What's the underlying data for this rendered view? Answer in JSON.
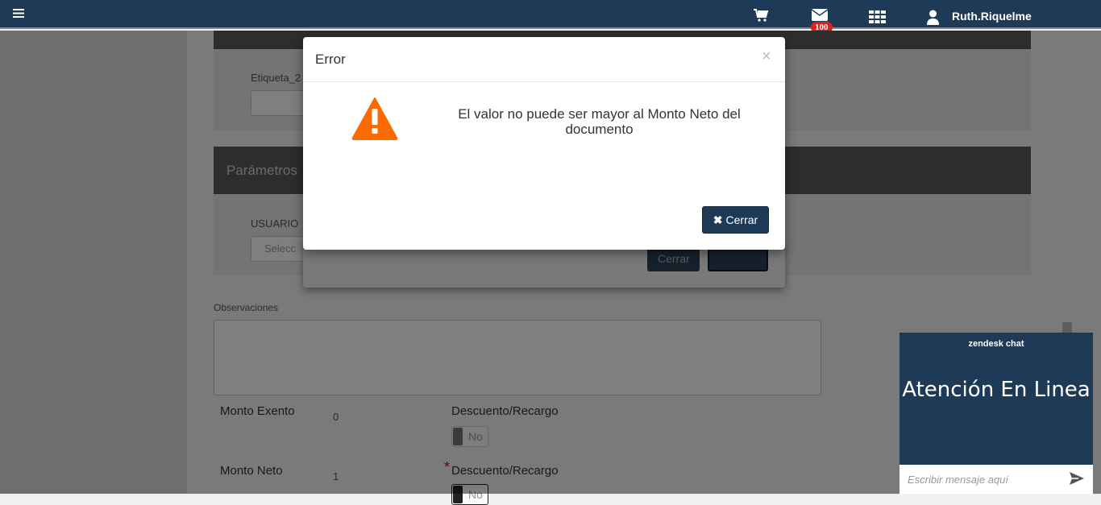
{
  "navbar": {
    "menu_icon": "hamburger-icon",
    "cart_icon": "cart-icon",
    "mail_icon": "envelope-icon",
    "mail_badge": "100",
    "apps_icon": "grid-icon",
    "user_icon": "user-icon",
    "username": "Ruth.Riquelme"
  },
  "background": {
    "field_label_1": "Etiqueta_2",
    "panel_title": "Parámetros",
    "usuario_label": "USUARIO",
    "usuario_placeholder": "Selecc",
    "under_cerrar": "Cerrar",
    "observaciones_label": "Observaciones",
    "monto_exento_label": "Monto Exento",
    "monto_exento_value": "0",
    "monto_neto_label": "Monto Neto",
    "monto_neto_value": "1",
    "descuento_label_1": "Descuento/Recargo",
    "descuento_label_2": "Descuento/Recargo",
    "required_mark": "*",
    "toggle_1": "No",
    "toggle_2": "No"
  },
  "modal": {
    "title": "Error",
    "close_symbol": "×",
    "icon": "warning-icon",
    "message": "El valor no puede ser mayor al Monto Neto del documento",
    "button_icon": "✖",
    "button_label": "Cerrar"
  },
  "chat": {
    "brand": "zendesk chat",
    "title": "Atención En Linea",
    "placeholder": "Escribir mensaje aquí",
    "send_icon": "send-icon"
  },
  "colors": {
    "navbar": "#1f3a56",
    "warning": "#ff6a00",
    "badge": "#e0201b",
    "button": "#1f3a56"
  }
}
